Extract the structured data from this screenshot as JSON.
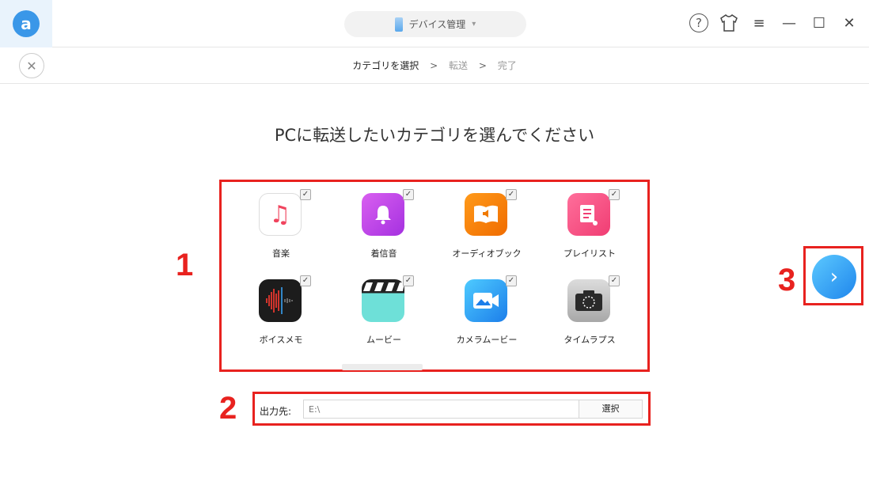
{
  "app": {
    "logo_letter": "a"
  },
  "header": {
    "device_label": "デバイス管理",
    "help_symbol": "?",
    "icons": [
      "help-icon",
      "skin-icon",
      "menu-icon",
      "minimize-icon",
      "maximize-icon",
      "close-icon"
    ]
  },
  "steps": {
    "items": [
      "カテゴリを選択",
      "転送",
      "完了"
    ],
    "separator": ">"
  },
  "heading": "PCに転送したいカテゴリを選んでください",
  "categories": [
    {
      "label": "音楽",
      "icon": "music-note-icon",
      "checked": true
    },
    {
      "label": "着信音",
      "icon": "bell-icon",
      "checked": true
    },
    {
      "label": "オーディオブック",
      "icon": "audiobook-icon",
      "checked": true
    },
    {
      "label": "プレイリスト",
      "icon": "playlist-icon",
      "checked": true
    },
    {
      "label": "ボイスメモ",
      "icon": "voice-memo-icon",
      "checked": true
    },
    {
      "label": "ムービー",
      "icon": "clapperboard-icon",
      "checked": true
    },
    {
      "label": "カメラムービー",
      "icon": "video-camera-icon",
      "checked": true
    },
    {
      "label": "タイムラプス",
      "icon": "timelapse-icon",
      "checked": true
    }
  ],
  "destination": {
    "label": "出力先:",
    "value": "E:\\",
    "button": "選択"
  },
  "annotations": {
    "n1": "1",
    "n2": "2",
    "n3": "3"
  },
  "colors": {
    "accent": "#1f86ec",
    "annotation": "#e8221f"
  }
}
